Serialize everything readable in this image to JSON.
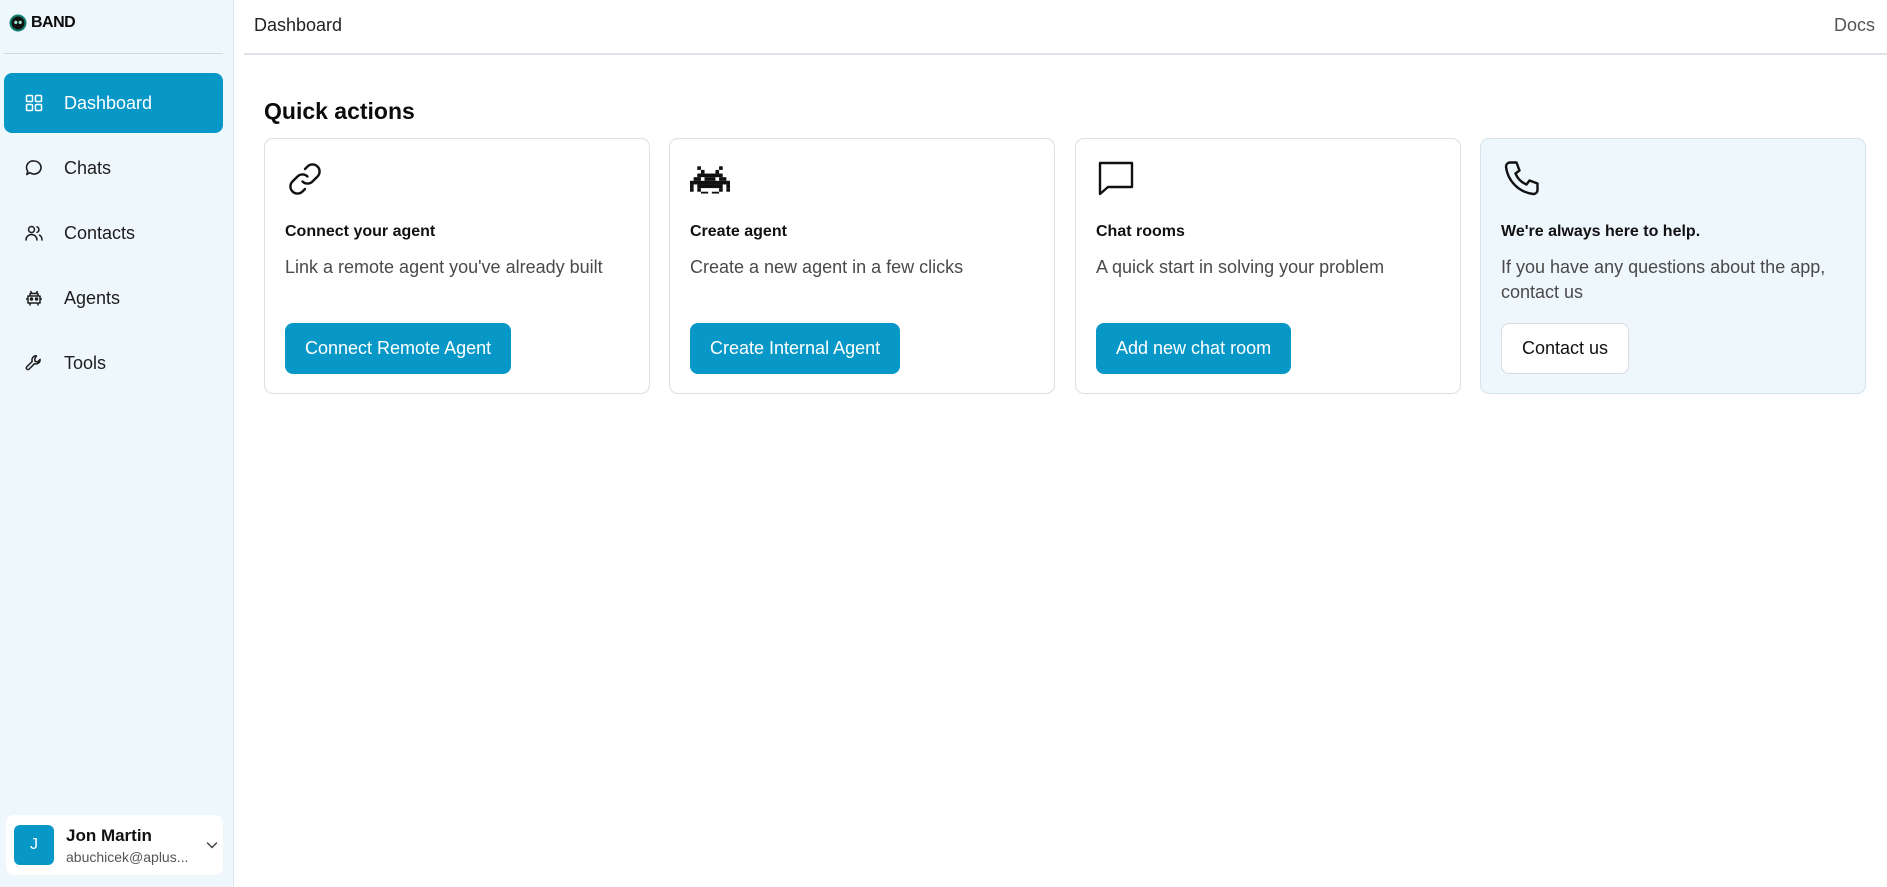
{
  "brand": {
    "name": "BAND"
  },
  "nav": {
    "items": [
      {
        "label": "Dashboard",
        "icon": "dashboard-grid-icon",
        "active": true
      },
      {
        "label": "Chats",
        "icon": "chat-bubble-icon",
        "active": false
      },
      {
        "label": "Contacts",
        "icon": "users-icon",
        "active": false
      },
      {
        "label": "Agents",
        "icon": "agents-icon",
        "active": false
      },
      {
        "label": "Tools",
        "icon": "wrench-icon",
        "active": false
      }
    ]
  },
  "user": {
    "initial": "J",
    "name": "Jon Martin",
    "email": "abuchicek@aplus..."
  },
  "topbar": {
    "breadcrumb": "Dashboard",
    "docs_link": "Docs"
  },
  "main": {
    "section_title": "Quick actions",
    "cards": [
      {
        "icon": "link-icon",
        "title": "Connect your agent",
        "description": "Link a remote agent you've already built",
        "button": "Connect Remote Agent"
      },
      {
        "icon": "space-invader-icon",
        "title": "Create agent",
        "description": "Create a new agent in a few clicks",
        "button": "Create Internal Agent"
      },
      {
        "icon": "chat-square-icon",
        "title": "Chat rooms",
        "description": "A quick start in solving your problem",
        "button": "Add new chat room"
      },
      {
        "icon": "phone-icon",
        "title": "We're always here to help.",
        "description": "If you have any questions about the app, contact us",
        "button": "Contact us"
      }
    ]
  },
  "colors": {
    "accent": "#0798c8",
    "sidebar_bg": "#eef7fc",
    "border": "#dadfe4"
  }
}
